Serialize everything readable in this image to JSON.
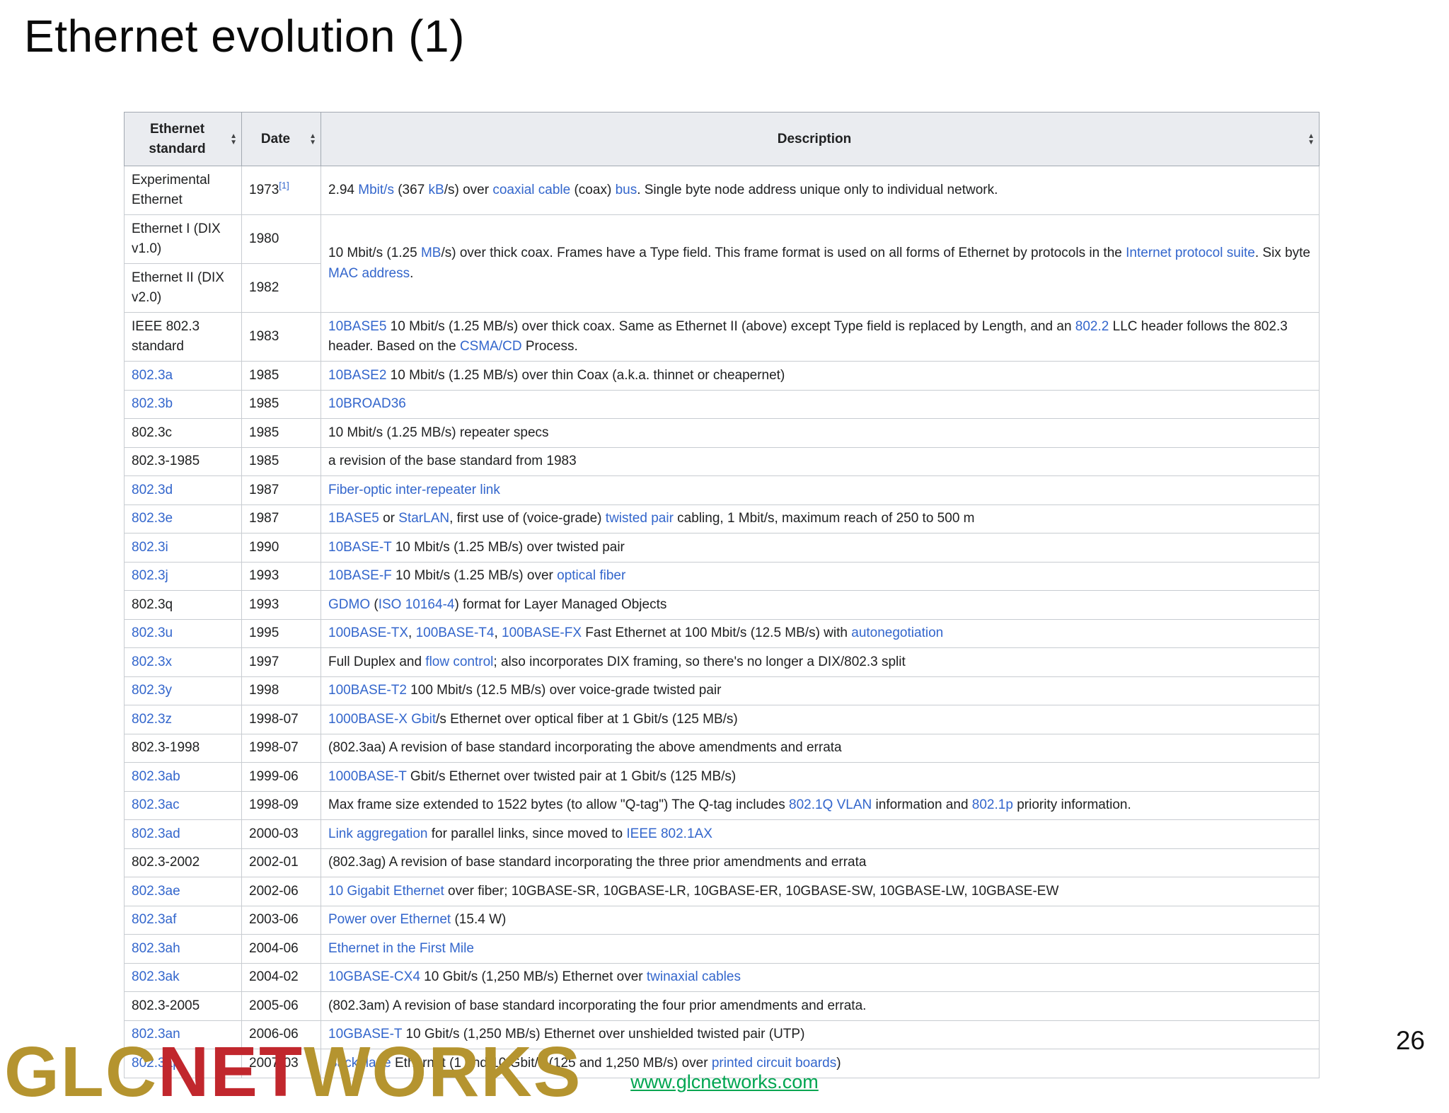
{
  "page": {
    "title": "Ethernet evolution (1)",
    "page_number": "26"
  },
  "colors": {
    "link_blue": "#3366cc",
    "header_gray": "#eaecf0",
    "logo_gold": "#b5942f",
    "logo_red": "#c1272d",
    "footer_link_green": "#00a651"
  },
  "icons": {
    "sort_up": "▲",
    "sort_down": "▼"
  },
  "footer": {
    "website_link": "www.glcnetworks.com",
    "logo_parts": [
      {
        "text": "GLC",
        "color": "gold"
      },
      {
        "text": "NET",
        "color": "red"
      },
      {
        "text": "WORKS",
        "color": "gold"
      }
    ]
  },
  "table": {
    "headers": [
      "Ethernet standard",
      "Date",
      "Description"
    ],
    "rows": [
      {
        "standard": {
          "text": "Experimental Ethernet",
          "link": false
        },
        "date": {
          "text": "1973",
          "ref": "[1]"
        },
        "desc": {
          "rowspan": 1,
          "segments": [
            {
              "t": "2.94 "
            },
            {
              "l": "Mbit/s"
            },
            {
              "t": " (367 "
            },
            {
              "l": "kB"
            },
            {
              "t": "/s) over "
            },
            {
              "l": "coaxial cable"
            },
            {
              "t": " (coax) "
            },
            {
              "l": "bus"
            },
            {
              "t": ". Single byte node address unique only to individual network."
            }
          ]
        }
      },
      {
        "standard": {
          "text": "Ethernet I (DIX v1.0)",
          "link": false
        },
        "date": {
          "text": "1980",
          "ref": null
        },
        "desc": {
          "rowspan": 2,
          "segments": [
            {
              "t": "10 Mbit/s (1.25 "
            },
            {
              "l": "MB"
            },
            {
              "t": "/s) over thick coax. Frames have a Type field. This frame format is used on all forms of Ethernet by protocols in the "
            },
            {
              "l": "Internet protocol suite"
            },
            {
              "t": ". Six byte "
            },
            {
              "l": "MAC address"
            },
            {
              "t": "."
            }
          ]
        }
      },
      {
        "standard": {
          "text": "Ethernet II (DIX v2.0)",
          "link": false
        },
        "date": {
          "text": "1982",
          "ref": null
        },
        "desc": null
      },
      {
        "standard": {
          "text": "IEEE 802.3 standard",
          "link": false
        },
        "date": {
          "text": "1983",
          "ref": null
        },
        "desc": {
          "rowspan": 1,
          "segments": [
            {
              "l": "10BASE5"
            },
            {
              "t": " 10 Mbit/s (1.25 MB/s) over thick coax. Same as Ethernet II (above) except Type field is replaced by Length, and an "
            },
            {
              "l": "802.2"
            },
            {
              "t": " LLC header follows the 802.3 header. Based on the "
            },
            {
              "l": "CSMA/CD"
            },
            {
              "t": " Process."
            }
          ]
        }
      },
      {
        "standard": {
          "text": "802.3a",
          "link": true
        },
        "date": {
          "text": "1985",
          "ref": null
        },
        "desc": {
          "rowspan": 1,
          "segments": [
            {
              "l": "10BASE2"
            },
            {
              "t": " 10 Mbit/s (1.25 MB/s) over thin Coax (a.k.a. thinnet or cheapernet)"
            }
          ]
        }
      },
      {
        "standard": {
          "text": "802.3b",
          "link": true
        },
        "date": {
          "text": "1985",
          "ref": null
        },
        "desc": {
          "rowspan": 1,
          "segments": [
            {
              "l": "10BROAD36"
            }
          ]
        }
      },
      {
        "standard": {
          "text": "802.3c",
          "link": false
        },
        "date": {
          "text": "1985",
          "ref": null
        },
        "desc": {
          "rowspan": 1,
          "segments": [
            {
              "t": "10 Mbit/s (1.25 MB/s) repeater specs"
            }
          ]
        }
      },
      {
        "standard": {
          "text": "802.3-1985",
          "link": false
        },
        "date": {
          "text": "1985",
          "ref": null
        },
        "desc": {
          "rowspan": 1,
          "segments": [
            {
              "t": "a revision of the base standard from 1983"
            }
          ]
        }
      },
      {
        "standard": {
          "text": "802.3d",
          "link": true
        },
        "date": {
          "text": "1987",
          "ref": null
        },
        "desc": {
          "rowspan": 1,
          "segments": [
            {
              "l": "Fiber-optic inter-repeater link"
            }
          ]
        }
      },
      {
        "standard": {
          "text": "802.3e",
          "link": true
        },
        "date": {
          "text": "1987",
          "ref": null
        },
        "desc": {
          "rowspan": 1,
          "segments": [
            {
              "l": "1BASE5"
            },
            {
              "t": " or "
            },
            {
              "l": "StarLAN"
            },
            {
              "t": ", first use of (voice-grade) "
            },
            {
              "l": "twisted pair"
            },
            {
              "t": " cabling, 1 Mbit/s, maximum reach of 250 to 500 m"
            }
          ]
        }
      },
      {
        "standard": {
          "text": "802.3i",
          "link": true
        },
        "date": {
          "text": "1990",
          "ref": null
        },
        "desc": {
          "rowspan": 1,
          "segments": [
            {
              "l": "10BASE-T"
            },
            {
              "t": " 10 Mbit/s (1.25 MB/s) over twisted pair"
            }
          ]
        }
      },
      {
        "standard": {
          "text": "802.3j",
          "link": true
        },
        "date": {
          "text": "1993",
          "ref": null
        },
        "desc": {
          "rowspan": 1,
          "segments": [
            {
              "l": "10BASE-F"
            },
            {
              "t": " 10 Mbit/s (1.25 MB/s) over "
            },
            {
              "l": "optical fiber"
            }
          ]
        }
      },
      {
        "standard": {
          "text": "802.3q",
          "link": false
        },
        "date": {
          "text": "1993",
          "ref": null
        },
        "desc": {
          "rowspan": 1,
          "segments": [
            {
              "l": "GDMO"
            },
            {
              "t": " ("
            },
            {
              "l": "ISO 10164-4"
            },
            {
              "t": ") format for Layer Managed Objects"
            }
          ]
        }
      },
      {
        "standard": {
          "text": "802.3u",
          "link": true
        },
        "date": {
          "text": "1995",
          "ref": null
        },
        "desc": {
          "rowspan": 1,
          "segments": [
            {
              "l": "100BASE-TX"
            },
            {
              "t": ", "
            },
            {
              "l": "100BASE-T4"
            },
            {
              "t": ", "
            },
            {
              "l": "100BASE-FX"
            },
            {
              "t": " Fast Ethernet at 100 Mbit/s (12.5 MB/s) with "
            },
            {
              "l": "autonegotiation"
            }
          ]
        }
      },
      {
        "standard": {
          "text": "802.3x",
          "link": true
        },
        "date": {
          "text": "1997",
          "ref": null
        },
        "desc": {
          "rowspan": 1,
          "segments": [
            {
              "t": "Full Duplex and "
            },
            {
              "l": "flow control"
            },
            {
              "t": "; also incorporates DIX framing, so there's no longer a DIX/802.3 split"
            }
          ]
        }
      },
      {
        "standard": {
          "text": "802.3y",
          "link": true
        },
        "date": {
          "text": "1998",
          "ref": null
        },
        "desc": {
          "rowspan": 1,
          "segments": [
            {
              "l": "100BASE-T2"
            },
            {
              "t": " 100 Mbit/s (12.5 MB/s) over voice-grade twisted pair"
            }
          ]
        }
      },
      {
        "standard": {
          "text": "802.3z",
          "link": true
        },
        "date": {
          "text": "1998-07",
          "ref": null
        },
        "desc": {
          "rowspan": 1,
          "segments": [
            {
              "l": "1000BASE-X"
            },
            {
              "t": " "
            },
            {
              "l": "Gbit"
            },
            {
              "t": "/s Ethernet over optical fiber at 1 Gbit/s (125 MB/s)"
            }
          ]
        }
      },
      {
        "standard": {
          "text": "802.3-1998",
          "link": false
        },
        "date": {
          "text": "1998-07",
          "ref": null
        },
        "desc": {
          "rowspan": 1,
          "segments": [
            {
              "t": "(802.3aa) A revision of base standard incorporating the above amendments and errata"
            }
          ]
        }
      },
      {
        "standard": {
          "text": "802.3ab",
          "link": true
        },
        "date": {
          "text": "1999-06",
          "ref": null
        },
        "desc": {
          "rowspan": 1,
          "segments": [
            {
              "l": "1000BASE-T"
            },
            {
              "t": " Gbit/s Ethernet over twisted pair at 1 Gbit/s (125 MB/s)"
            }
          ]
        }
      },
      {
        "standard": {
          "text": "802.3ac",
          "link": true
        },
        "date": {
          "text": "1998-09",
          "ref": null
        },
        "desc": {
          "rowspan": 1,
          "segments": [
            {
              "t": "Max frame size extended to 1522 bytes (to allow \"Q-tag\") The Q-tag includes "
            },
            {
              "l": "802.1Q VLAN"
            },
            {
              "t": " information and "
            },
            {
              "l": "802.1p"
            },
            {
              "t": " priority information."
            }
          ]
        }
      },
      {
        "standard": {
          "text": "802.3ad",
          "link": true
        },
        "date": {
          "text": "2000-03",
          "ref": null
        },
        "desc": {
          "rowspan": 1,
          "segments": [
            {
              "l": "Link aggregation"
            },
            {
              "t": " for parallel links, since moved to "
            },
            {
              "l": "IEEE 802.1AX"
            }
          ]
        }
      },
      {
        "standard": {
          "text": "802.3-2002",
          "link": false
        },
        "date": {
          "text": "2002-01",
          "ref": null
        },
        "desc": {
          "rowspan": 1,
          "segments": [
            {
              "t": "(802.3ag) A revision of base standard incorporating the three prior amendments and errata"
            }
          ]
        }
      },
      {
        "standard": {
          "text": "802.3ae",
          "link": true
        },
        "date": {
          "text": "2002-06",
          "ref": null
        },
        "desc": {
          "rowspan": 1,
          "segments": [
            {
              "l": "10 Gigabit Ethernet"
            },
            {
              "t": " over fiber; 10GBASE-SR, 10GBASE-LR, 10GBASE-ER, 10GBASE-SW, 10GBASE-LW, 10GBASE-EW"
            }
          ]
        }
      },
      {
        "standard": {
          "text": "802.3af",
          "link": true
        },
        "date": {
          "text": "2003-06",
          "ref": null
        },
        "desc": {
          "rowspan": 1,
          "segments": [
            {
              "l": "Power over Ethernet"
            },
            {
              "t": " (15.4 W)"
            }
          ]
        }
      },
      {
        "standard": {
          "text": "802.3ah",
          "link": true
        },
        "date": {
          "text": "2004-06",
          "ref": null
        },
        "desc": {
          "rowspan": 1,
          "segments": [
            {
              "l": "Ethernet in the First Mile"
            }
          ]
        }
      },
      {
        "standard": {
          "text": "802.3ak",
          "link": true
        },
        "date": {
          "text": "2004-02",
          "ref": null
        },
        "desc": {
          "rowspan": 1,
          "segments": [
            {
              "l": "10GBASE-CX4"
            },
            {
              "t": " 10 Gbit/s (1,250 MB/s) Ethernet over "
            },
            {
              "l": "twinaxial cables"
            }
          ]
        }
      },
      {
        "standard": {
          "text": "802.3-2005",
          "link": false
        },
        "date": {
          "text": "2005-06",
          "ref": null
        },
        "desc": {
          "rowspan": 1,
          "segments": [
            {
              "t": "(802.3am) A revision of base standard incorporating the four prior amendments and errata."
            }
          ]
        }
      },
      {
        "standard": {
          "text": "802.3an",
          "link": true
        },
        "date": {
          "text": "2006-06",
          "ref": null
        },
        "desc": {
          "rowspan": 1,
          "segments": [
            {
              "l": "10GBASE-T"
            },
            {
              "t": " 10 Gbit/s (1,250 MB/s) Ethernet over unshielded twisted pair (UTP)"
            }
          ]
        }
      },
      {
        "standard": {
          "text": "802.3ap",
          "link": true
        },
        "date": {
          "text": "2007-03",
          "ref": null
        },
        "desc": {
          "rowspan": 1,
          "segments": [
            {
              "l": "Backplane"
            },
            {
              "t": " Ethernet (1 and 10 Gbit/s (125 and 1,250 MB/s) over "
            },
            {
              "l": "printed circuit boards"
            },
            {
              "t": ")"
            }
          ]
        }
      }
    ]
  }
}
